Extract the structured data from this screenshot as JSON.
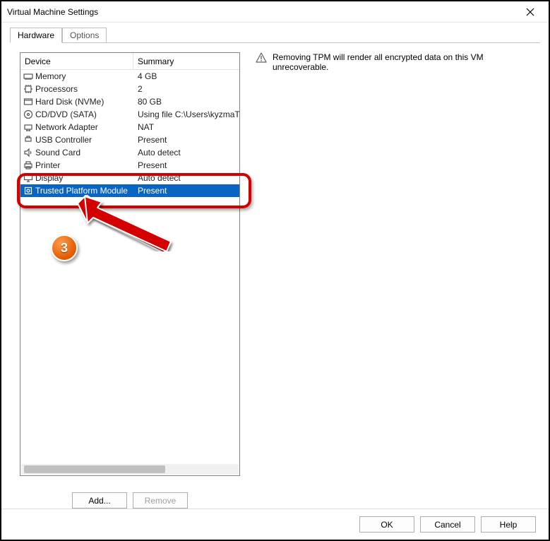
{
  "window": {
    "title": "Virtual Machine Settings"
  },
  "tabs": {
    "hardware": "Hardware",
    "options": "Options"
  },
  "columns": {
    "device": "Device",
    "summary": "Summary"
  },
  "devices": [
    {
      "icon": "memory",
      "name": "Memory",
      "summary": "4 GB"
    },
    {
      "icon": "cpu",
      "name": "Processors",
      "summary": "2"
    },
    {
      "icon": "disk",
      "name": "Hard Disk (NVMe)",
      "summary": "80 GB"
    },
    {
      "icon": "cd",
      "name": "CD/DVD (SATA)",
      "summary": "Using file C:\\Users\\kyzmaT"
    },
    {
      "icon": "net",
      "name": "Network Adapter",
      "summary": "NAT"
    },
    {
      "icon": "usb",
      "name": "USB Controller",
      "summary": "Present"
    },
    {
      "icon": "sound",
      "name": "Sound Card",
      "summary": "Auto detect"
    },
    {
      "icon": "printer",
      "name": "Printer",
      "summary": "Present"
    },
    {
      "icon": "display",
      "name": "Display",
      "summary": "Auto detect"
    },
    {
      "icon": "tpm",
      "name": "Trusted Platform Module",
      "summary": "Present",
      "selected": true
    }
  ],
  "buttons": {
    "add": "Add...",
    "remove": "Remove",
    "ok": "OK",
    "cancel": "Cancel",
    "help": "Help"
  },
  "right": {
    "warning": "Removing TPM will render all encrypted data on this VM unrecoverable."
  },
  "annotation": {
    "step": "3"
  }
}
